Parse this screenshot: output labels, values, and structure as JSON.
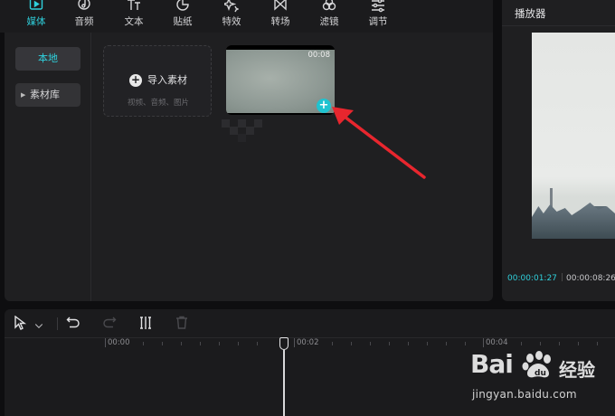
{
  "toolbar": {
    "items": [
      {
        "label": "媒体",
        "icon": "media-play-icon",
        "active": true
      },
      {
        "label": "音频",
        "icon": "music-note-icon"
      },
      {
        "label": "文本",
        "icon": "text-icon"
      },
      {
        "label": "贴纸",
        "icon": "sticker-icon"
      },
      {
        "label": "特效",
        "icon": "sparkle-icon"
      },
      {
        "label": "转场",
        "icon": "transition-icon"
      },
      {
        "label": "滤镜",
        "icon": "filter-icon"
      },
      {
        "label": "调节",
        "icon": "adjust-sliders-icon"
      }
    ]
  },
  "media": {
    "nav": {
      "local": "本地",
      "library": "素材库"
    },
    "import": {
      "label": "导入素材",
      "sub": "视频、音频、图片"
    },
    "clip": {
      "duration": "00:08"
    }
  },
  "player": {
    "title": "播放器",
    "current_time": "00:00:01:27",
    "separator": "|",
    "total_time": "00:00:08:26"
  },
  "timeline": {
    "ruler": [
      "00:00",
      "00:02",
      "00:04"
    ]
  },
  "watermark": {
    "brand": "Bai",
    "brand_tail": "经验",
    "url": "jingyan.baidu.com"
  },
  "colors": {
    "accent": "#2fd0dc",
    "arrow": "#e8262e",
    "add_button": "#1fc3d0"
  }
}
